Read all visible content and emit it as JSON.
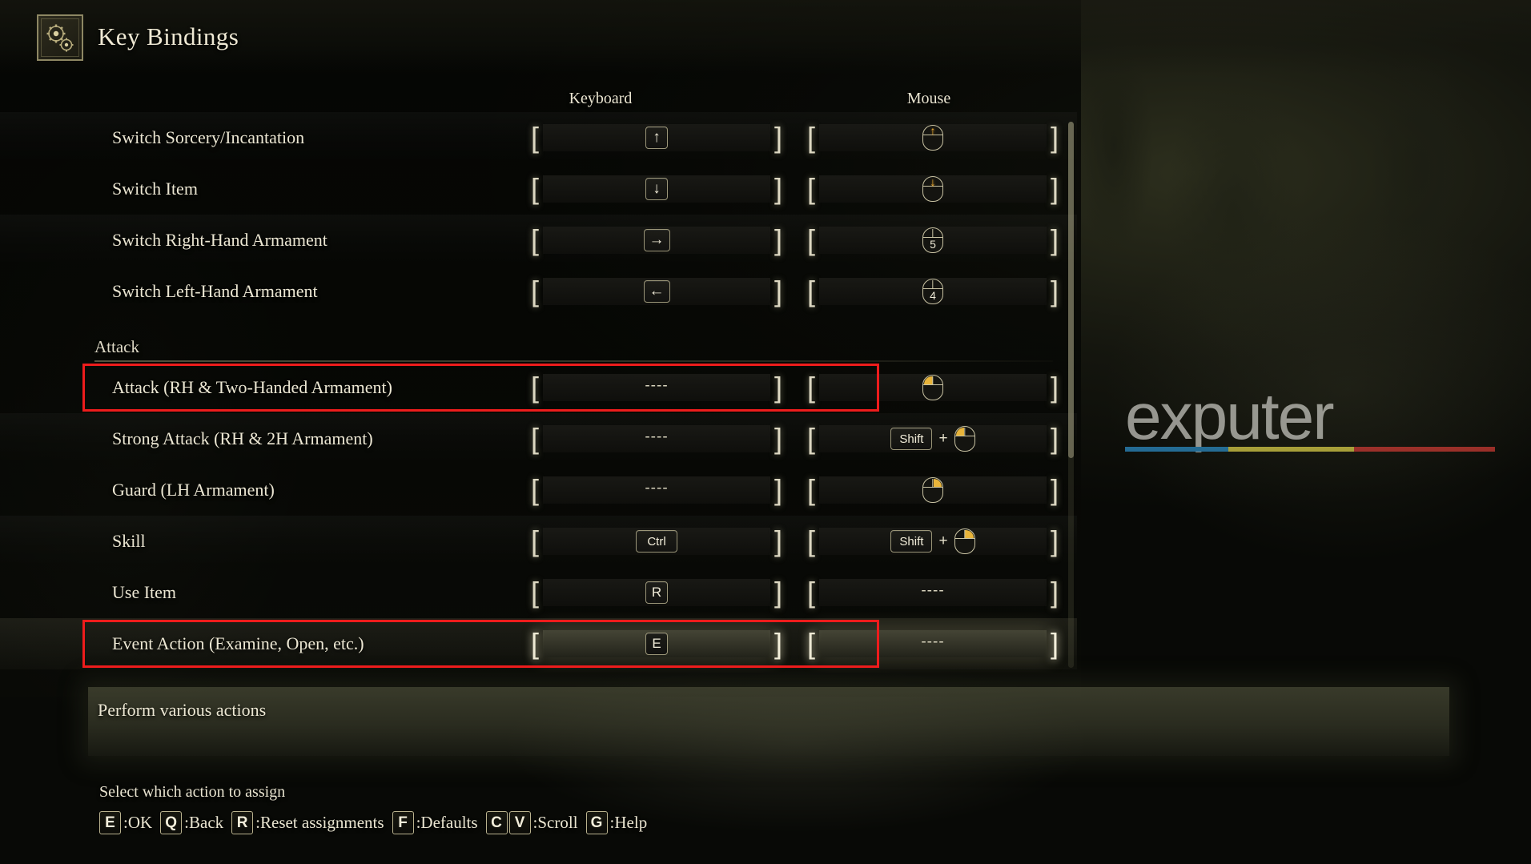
{
  "header": {
    "title": "Key Bindings",
    "icon": "gears-icon"
  },
  "columns": {
    "keyboard": "Keyboard",
    "mouse": "Mouse"
  },
  "rows": [
    {
      "type": "binding",
      "label": "Switch Sorcery/Incantation",
      "keyboard": {
        "kind": "key",
        "keys": [
          "↑"
        ]
      },
      "mouse": {
        "kind": "mouse",
        "icon": "mouse-wheel-up-icon",
        "glyph": "↑"
      },
      "highlighted": false,
      "selected": false
    },
    {
      "type": "binding",
      "label": "Switch Item",
      "keyboard": {
        "kind": "key",
        "keys": [
          "↓"
        ]
      },
      "mouse": {
        "kind": "mouse",
        "icon": "mouse-wheel-down-icon",
        "glyph": "↓"
      },
      "highlighted": false,
      "selected": false
    },
    {
      "type": "binding",
      "label": "Switch Right-Hand Armament",
      "keyboard": {
        "kind": "key",
        "keys": [
          "→"
        ]
      },
      "mouse": {
        "kind": "mouse",
        "icon": "mouse-button-5-icon",
        "num": "5"
      },
      "highlighted": false,
      "selected": false
    },
    {
      "type": "binding",
      "label": "Switch Left-Hand Armament",
      "keyboard": {
        "kind": "key",
        "keys": [
          "←"
        ]
      },
      "mouse": {
        "kind": "mouse",
        "icon": "mouse-button-4-icon",
        "num": "4"
      },
      "highlighted": false,
      "selected": false
    },
    {
      "type": "section",
      "label": "Attack"
    },
    {
      "type": "binding",
      "label": "Attack (RH & Two-Handed Armament)",
      "keyboard": {
        "kind": "empty",
        "value": "----"
      },
      "mouse": {
        "kind": "mouse",
        "icon": "mouse-left-button-icon",
        "button": "left"
      },
      "highlighted": true,
      "selected": false
    },
    {
      "type": "binding",
      "label": "Strong Attack (RH & 2H Armament)",
      "keyboard": {
        "kind": "empty",
        "value": "----"
      },
      "mouse": {
        "kind": "combo",
        "modifier": "Shift",
        "icon": "mouse-left-button-icon",
        "button": "left"
      },
      "highlighted": false,
      "selected": false
    },
    {
      "type": "binding",
      "label": "Guard (LH Armament)",
      "keyboard": {
        "kind": "empty",
        "value": "----"
      },
      "mouse": {
        "kind": "mouse",
        "icon": "mouse-right-button-icon",
        "button": "right"
      },
      "highlighted": false,
      "selected": false
    },
    {
      "type": "binding",
      "label": "Skill",
      "keyboard": {
        "kind": "key",
        "keys": [
          "Ctrl"
        ]
      },
      "mouse": {
        "kind": "combo",
        "modifier": "Shift",
        "icon": "mouse-right-button-icon",
        "button": "right"
      },
      "highlighted": false,
      "selected": false
    },
    {
      "type": "binding",
      "label": "Use Item",
      "keyboard": {
        "kind": "key",
        "keys": [
          "R"
        ]
      },
      "mouse": {
        "kind": "empty",
        "value": "----"
      },
      "highlighted": false,
      "selected": false
    },
    {
      "type": "binding",
      "label": "Event Action (Examine, Open, etc.)",
      "keyboard": {
        "kind": "key",
        "keys": [
          "E"
        ]
      },
      "mouse": {
        "kind": "empty",
        "value": "----"
      },
      "highlighted": true,
      "selected": true
    }
  ],
  "description": "Perform various actions",
  "footer": {
    "hint": "Select which action to assign",
    "actions": [
      {
        "keys": [
          "E"
        ],
        "label": ":OK"
      },
      {
        "keys": [
          "Q"
        ],
        "label": ":Back"
      },
      {
        "keys": [
          "R"
        ],
        "label": ":Reset assignments"
      },
      {
        "keys": [
          "F"
        ],
        "label": ":Defaults"
      },
      {
        "keys": [
          "C",
          "V"
        ],
        "label": ":Scroll"
      },
      {
        "keys": [
          "G"
        ],
        "label": ":Help"
      }
    ]
  },
  "watermark": {
    "text": "exputer",
    "bar_colors": [
      "#2d8fc9",
      "#e0d44a",
      "#cf3b34"
    ]
  },
  "annotations": [
    {
      "name": "attack-rh-row-highlight",
      "color": "#ee1c1c"
    },
    {
      "name": "event-action-row-highlight",
      "color": "#ee1c1c"
    }
  ],
  "colors": {
    "accent_gold": "#e8b43a",
    "text_primary": "#ece7d3",
    "annotation_red": "#ee1c1c"
  }
}
